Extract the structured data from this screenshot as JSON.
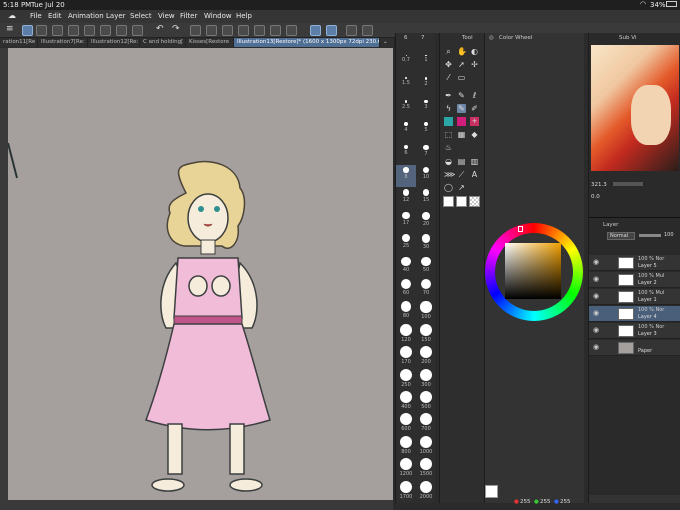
{
  "status": {
    "time": "5:18 PM",
    "date": "Tue Jul 20",
    "battery": "34%"
  },
  "menu": [
    "File",
    "Edit",
    "Animation",
    "Layer",
    "Select",
    "View",
    "Filter",
    "Window",
    "Help"
  ],
  "tabs": [
    "ration11[Re",
    "Illustration7[Re:",
    "Illustration12[Re:",
    "C and holding[",
    "Kisses[Restore",
    "Illustration13[Restore]* (1600 x 1300px 72dpi 230.6%)"
  ],
  "brush": {
    "tab1": "6",
    "tab2": "7",
    "sizes": [
      "0.7",
      "1",
      "1.5",
      "2",
      "2.5",
      "3",
      "4",
      "5",
      "6",
      "7",
      "8",
      "10",
      "12",
      "15",
      "17",
      "20",
      "25",
      "30",
      "40",
      "50",
      "60",
      "70",
      "80",
      "100",
      "120",
      "150",
      "170",
      "200",
      "250",
      "300",
      "400",
      "500",
      "600",
      "700",
      "800",
      "1000",
      "1200",
      "1500",
      "1700",
      "2000"
    ]
  },
  "tool_panel": {
    "title": "Tool"
  },
  "color_panel": {
    "title": "Color Wheel",
    "r": "255",
    "g": "255",
    "b": "255"
  },
  "navigator": {
    "tab": "Sub Vi",
    "zoom": "321.3",
    "angle": "0.0"
  },
  "layer_panel": {
    "tab": "Layer",
    "blend": "Normal",
    "opacity": "100",
    "layers": [
      {
        "mode": "100 % Nor",
        "name": "Layer 5"
      },
      {
        "mode": "100 % Mul",
        "name": "Layer 2"
      },
      {
        "mode": "100 % Mul",
        "name": "Layer 1"
      },
      {
        "mode": "100 % Nor",
        "name": "Layer 4"
      },
      {
        "mode": "100 % Nor",
        "name": "Layer 3"
      },
      {
        "mode": "",
        "name": "Paper"
      }
    ]
  }
}
